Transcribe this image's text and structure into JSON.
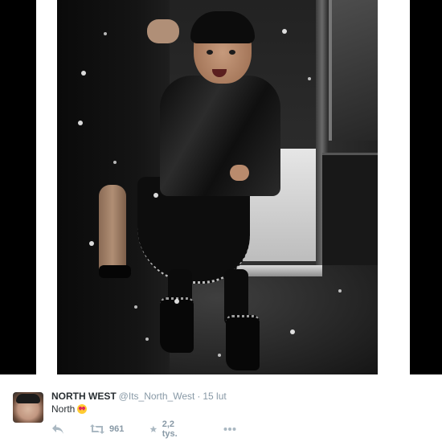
{
  "tweet": {
    "display_name": "NORTH WEST",
    "handle": "@Its_North_West",
    "separator": "·",
    "timestamp": "15 lut",
    "text": "North",
    "emoji": "heart-eyes-emoji"
  },
  "actions": {
    "reply_icon": "reply-icon",
    "retweet_icon": "retweet-icon",
    "retweet_count": "961",
    "favorite_icon": "star-icon",
    "favorite_count": "2,2 tys.",
    "more_icon": "more-icon"
  },
  "colors": {
    "name": "#292f33",
    "meta": "#8899a6",
    "letterbox": "#000000"
  }
}
